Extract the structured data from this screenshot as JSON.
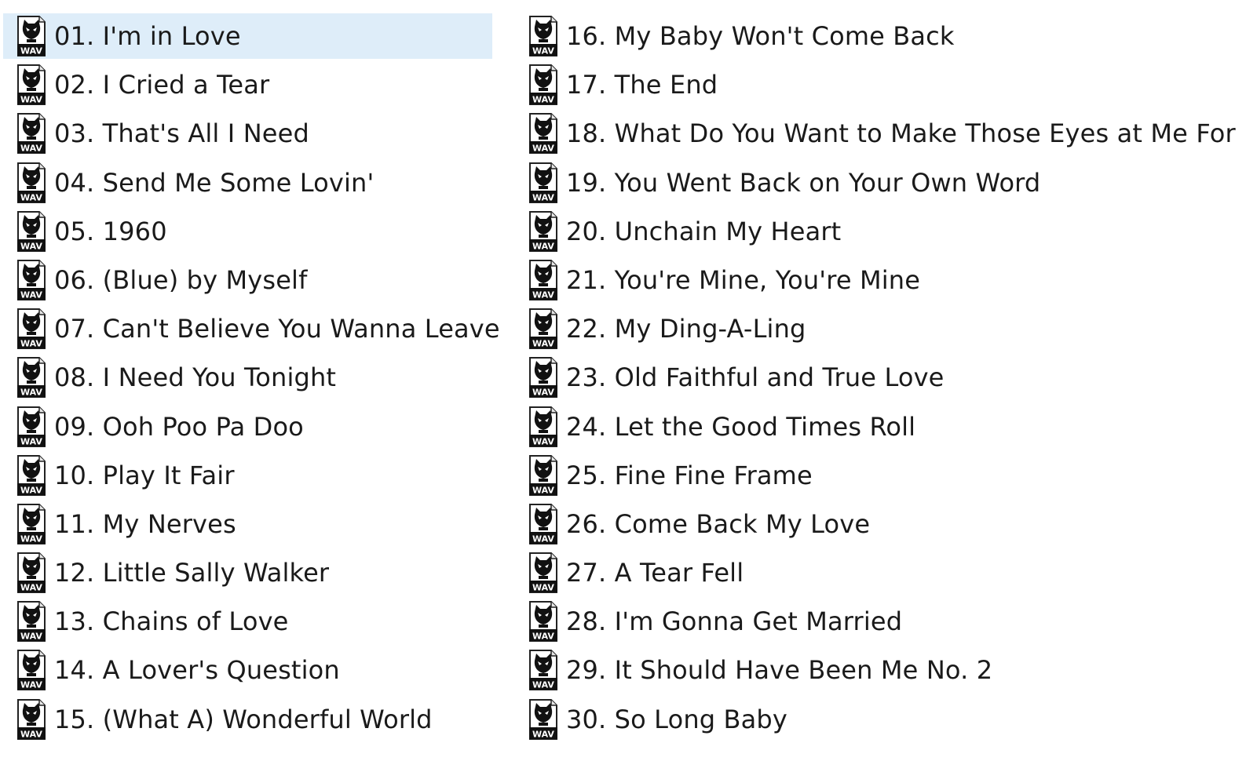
{
  "icon": {
    "name": "wav-file-icon",
    "badge_text": "WAV"
  },
  "colors": {
    "selected_background": "#deedf9",
    "text": "#1a1a1a"
  },
  "files": {
    "left": [
      {
        "label": "01. I'm in Love",
        "selected": true
      },
      {
        "label": "02. I Cried a Tear"
      },
      {
        "label": "03. That's All I Need"
      },
      {
        "label": "04. Send Me Some Lovin'"
      },
      {
        "label": "05. 1960"
      },
      {
        "label": "06. (Blue) by Myself"
      },
      {
        "label": "07. Can't Believe You Wanna Leave"
      },
      {
        "label": "08. I Need You Tonight"
      },
      {
        "label": "09. Ooh Poo Pa Doo"
      },
      {
        "label": "10. Play It Fair"
      },
      {
        "label": "11. My Nerves"
      },
      {
        "label": "12. Little Sally Walker"
      },
      {
        "label": "13. Chains of Love"
      },
      {
        "label": "14. A Lover's Question"
      },
      {
        "label": "15. (What A) Wonderful World"
      }
    ],
    "right": [
      {
        "label": "16. My Baby Won't Come Back"
      },
      {
        "label": "17. The End"
      },
      {
        "label": "18. What Do You Want to Make Those Eyes at Me For"
      },
      {
        "label": "19. You Went Back on Your Own Word"
      },
      {
        "label": "20. Unchain My Heart"
      },
      {
        "label": "21. You're Mine, You're Mine"
      },
      {
        "label": "22. My Ding-A-Ling"
      },
      {
        "label": "23. Old Faithful and True Love"
      },
      {
        "label": "24. Let the Good Times Roll"
      },
      {
        "label": "25. Fine Fine Frame"
      },
      {
        "label": "26. Come Back My Love"
      },
      {
        "label": "27. A Tear Fell"
      },
      {
        "label": "28. I'm Gonna Get Married"
      },
      {
        "label": "29. It Should Have Been Me No. 2"
      },
      {
        "label": "30. So Long Baby"
      }
    ]
  }
}
